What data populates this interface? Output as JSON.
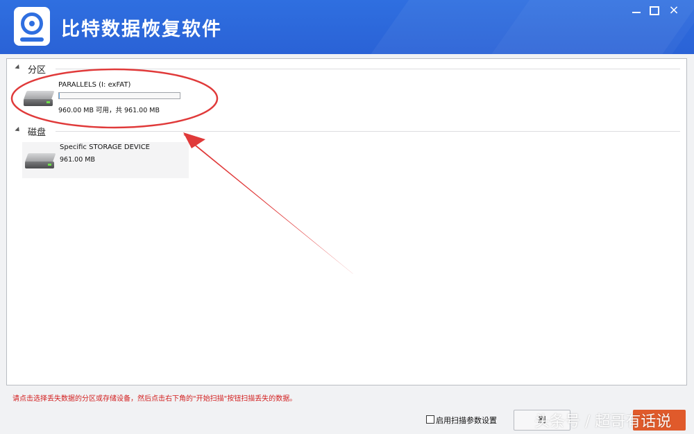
{
  "window": {
    "title": "比特数据恢复软件",
    "controls": {
      "minimize": "minimize-icon",
      "maximize": "maximize-icon",
      "close": "×"
    }
  },
  "sections": {
    "partition": {
      "label": "分区",
      "items": [
        {
          "name": "PARALLELS (I: exFAT)",
          "size": "960.00 MB 可用，共 961.00 MB",
          "used_fraction": 0.001
        }
      ]
    },
    "disk": {
      "label": "磁盘",
      "items": [
        {
          "name": "Specific STORAGE DEVICE",
          "size": "961.00 MB"
        }
      ]
    }
  },
  "footer": {
    "hint": "请点击选择丢失数据的分区或存储设备，然后点击右下角的\"开始扫描\"按钮扫描丢失的数据。",
    "scan_option_label": "启用扫描参数设置",
    "refresh_label": "刷",
    "watermark": "头条号 / 超哥有话说"
  },
  "colors": {
    "titlebar": "#2f6fe0",
    "annotation": "#e03a3a",
    "hint_text": "#d21e1e",
    "start_button": "#e05a2b"
  }
}
